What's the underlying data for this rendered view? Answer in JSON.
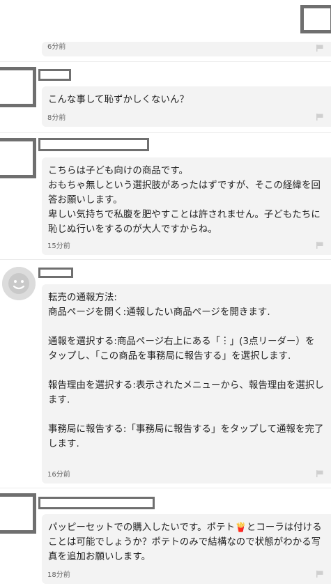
{
  "comments": [
    {
      "time": "6分前"
    },
    {
      "text": "こんな事して恥ずかしくないん？",
      "time": "8分前"
    },
    {
      "text": "こちらは子ども向けの商品です。\nおもちゃ無しという選択肢があったはずですが、そこの経緯を回答お願いします。\n卑しい気持ちで私腹を肥やすことは許されません。子どもたちに恥じぬ行いをするのが大人ですからね。",
      "time": "15分前"
    },
    {
      "text": "転売の通報方法:\n商品ページを開く:通報したい商品ページを開きます.\n\n通報を選択する:商品ページ右上にある「︙」(3点リーダー）をタップし、「この商品を事務局に報告する」を選択します.\n\n報告理由を選択する:表示されたメニューから、報告理由を選択します.\n\n事務局に報告する:「事務局に報告する」をタップして通報を完了します.",
      "time": "16分前"
    },
    {
      "text": "パッピーセットでの購入したいです。ポテト🍟とコーラは付けることは可能でしょうか？ポテトのみで結構なので状態がわかる写真を追加お願いします。",
      "time": "18分前"
    }
  ],
  "icons": {
    "report": "flag-icon",
    "avatar": "default-avatar-icon"
  },
  "colors": {
    "bubble": "#f3f3f3",
    "redaction": "#6f6f6f",
    "meta_text": "#666666"
  }
}
